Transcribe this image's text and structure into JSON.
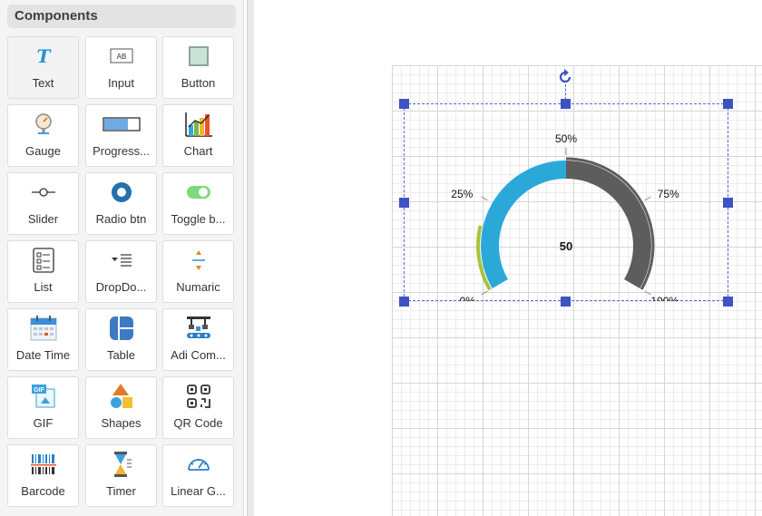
{
  "panel": {
    "title": "Components",
    "items": [
      {
        "label": "Text",
        "icon": "text-icon"
      },
      {
        "label": "Input",
        "icon": "input-icon"
      },
      {
        "label": "Button",
        "icon": "button-icon"
      },
      {
        "label": "Gauge",
        "icon": "gauge-icon"
      },
      {
        "label": "Progress...",
        "icon": "progress-bar-icon"
      },
      {
        "label": "Chart",
        "icon": "chart-icon"
      },
      {
        "label": "Slider",
        "icon": "slider-icon"
      },
      {
        "label": "Radio btn",
        "icon": "radio-icon"
      },
      {
        "label": "Toggle b...",
        "icon": "toggle-icon"
      },
      {
        "label": "List",
        "icon": "list-icon"
      },
      {
        "label": "DropDo...",
        "icon": "dropdown-icon"
      },
      {
        "label": "Numaric",
        "icon": "numeric-icon"
      },
      {
        "label": "Date Time",
        "icon": "calendar-icon"
      },
      {
        "label": "Table",
        "icon": "table-icon"
      },
      {
        "label": "Adi Com...",
        "icon": "conveyor-icon"
      },
      {
        "label": "GIF",
        "icon": "gif-icon"
      },
      {
        "label": "Shapes",
        "icon": "shapes-icon"
      },
      {
        "label": "QR Code",
        "icon": "qr-code-icon"
      },
      {
        "label": "Barcode",
        "icon": "barcode-icon"
      },
      {
        "label": "Timer",
        "icon": "hourglass-icon"
      },
      {
        "label": "Linear G...",
        "icon": "linear-gauge-icon"
      }
    ]
  },
  "gauge": {
    "value": 50,
    "value_label": "50",
    "min": 0,
    "max": 100,
    "ticks": [
      "0%",
      "25%",
      "50%",
      "75%",
      "100%"
    ],
    "colors": {
      "fill": "#2aa9d9",
      "track": "#5d5d5d",
      "low_band": "#a8c33a",
      "accent": "#3e52c2"
    }
  }
}
